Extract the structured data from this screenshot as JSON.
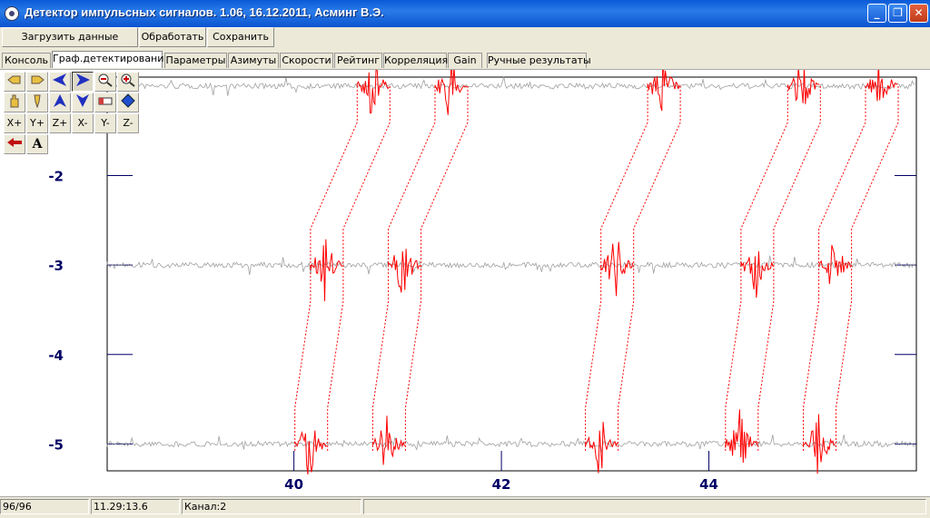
{
  "window": {
    "title": "Детектор импульсных сигналов. 1.06, 16.12.2011, Асминг В.Э."
  },
  "toolbar": {
    "load": "Загрузить данные",
    "process": "Обработать",
    "save": "Сохранить"
  },
  "tabs": [
    "Консоль",
    "Граф.детектирования",
    "Параметры",
    "Азимуты",
    "Скорости",
    "Рейтинг",
    "Корреляция",
    "Gain",
    "Ручные результаты"
  ],
  "active_tab": "Граф.детектирования",
  "plot_tools": {
    "icons": [
      "hand-left-icon",
      "hand-right-icon",
      "arrow-left-icon",
      "arrow-right-icon",
      "zoom-out-icon",
      "zoom-in-icon",
      "hand-grab-icon",
      "pin-icon",
      "arrow-up-icon",
      "arrow-down-icon",
      "eraser-icon",
      "diamond-icon",
      "back-arrow-icon",
      "font-a-icon"
    ],
    "labels": [
      "X+",
      "Y+",
      "Z+",
      "X-",
      "Y-",
      "Z-"
    ],
    "font_glyph": "A"
  },
  "colors": {
    "trace": "#a0a0a0",
    "detection": "#ff0000",
    "axis_label": "#000066",
    "accent": "#0a54d0"
  },
  "chart_data": {
    "type": "line",
    "x_ticks": [
      "40",
      "42",
      "44"
    ],
    "y_ticks": [
      "-2",
      "-3",
      "-4",
      "-5"
    ],
    "xlim": [
      38.2,
      46.0
    ],
    "ylim": [
      -5.3,
      -0.9
    ],
    "traces": [
      -1,
      -3,
      -5
    ],
    "detections": [
      40.3,
      41.05,
      43.1,
      44.45,
      45.2
    ]
  },
  "status": {
    "count": "96/96",
    "time": "11.29:13.6",
    "channel": "Канал:2"
  }
}
